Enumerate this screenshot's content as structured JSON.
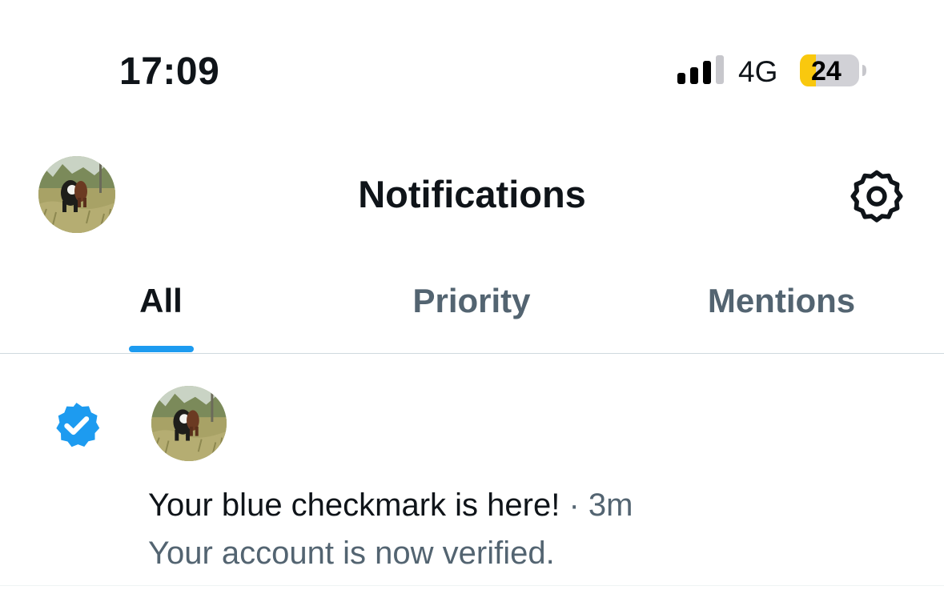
{
  "status_bar": {
    "time": "17:09",
    "network": "4G",
    "battery_level": "24",
    "signal_icon": "cellular-signal-icon",
    "battery_icon": "battery-icon",
    "battery_fill_fraction": 0.24,
    "battery_color": "#f9c80e"
  },
  "header": {
    "title": "Notifications",
    "avatar_icon": "profile-avatar",
    "settings_icon": "gear-icon"
  },
  "tabs": [
    {
      "label": "All",
      "active": true
    },
    {
      "label": "Priority",
      "active": false
    },
    {
      "label": "Mentions",
      "active": false
    }
  ],
  "notifications": [
    {
      "icon": "verified-badge-icon",
      "title": "Your blue checkmark is here!",
      "separator": "·",
      "time": "3m",
      "subtitle": "Your account is now verified."
    }
  ],
  "colors": {
    "accent": "#1d9bf0",
    "text_primary": "#0f1419",
    "text_secondary": "#536471",
    "divider": "#cfd9de"
  }
}
